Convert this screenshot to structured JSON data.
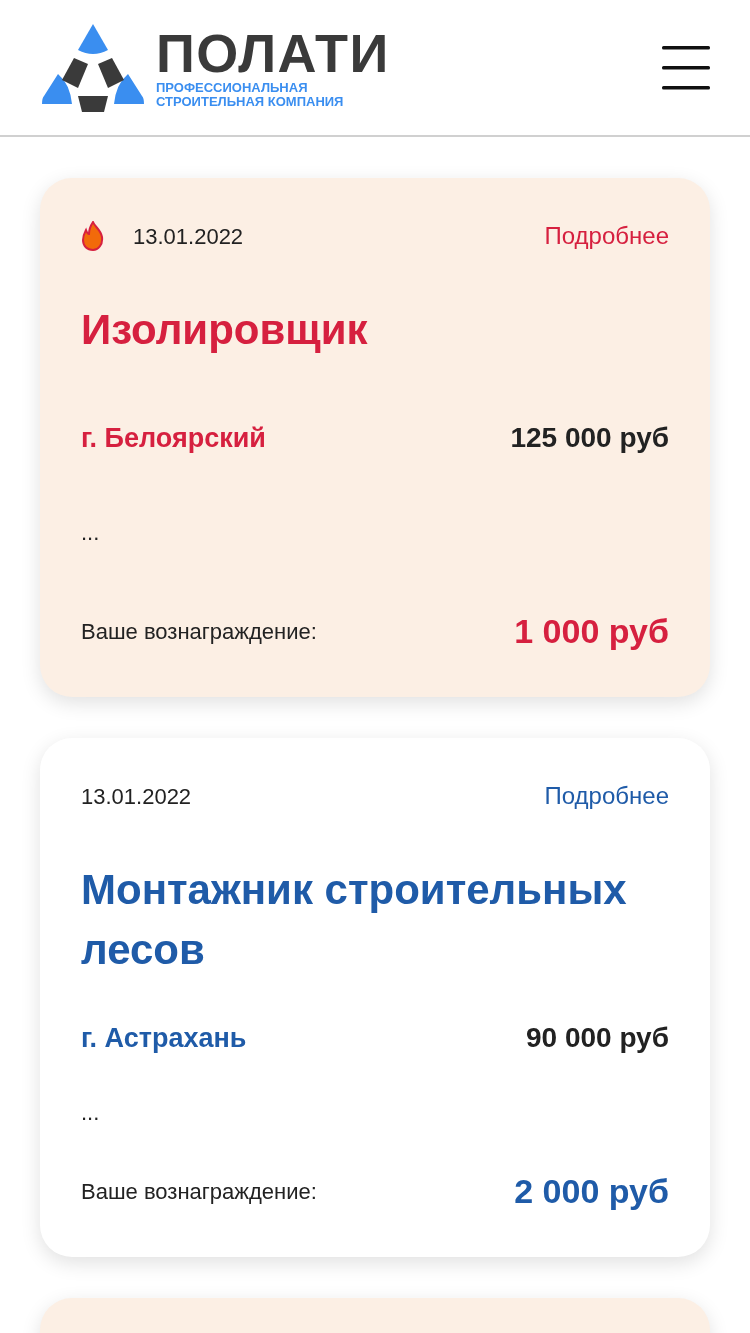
{
  "header": {
    "brand": "ПОЛАТИ",
    "tagline_1": "ПРОФЕССИОНАЛЬНАЯ",
    "tagline_2": "СТРОИТЕЛЬНАЯ КОМПАНИЯ"
  },
  "vacancies": [
    {
      "hot": true,
      "date": "13.01.2022",
      "link": "Подробнее",
      "title": "Изолировщик",
      "city": "г. Белоярский",
      "salary": "125 000 руб",
      "description": "...",
      "reward_label": "Ваше вознаграждение:",
      "reward": "1 000 руб"
    },
    {
      "hot": false,
      "date": "13.01.2022",
      "link": "Подробнее",
      "title": "Монтажник строительных лесов",
      "city": "г. Астрахань",
      "salary": "90 000 руб",
      "description": "...",
      "reward_label": "Ваше вознаграждение:",
      "reward": "2 000 руб"
    },
    {
      "hot": true
    }
  ]
}
